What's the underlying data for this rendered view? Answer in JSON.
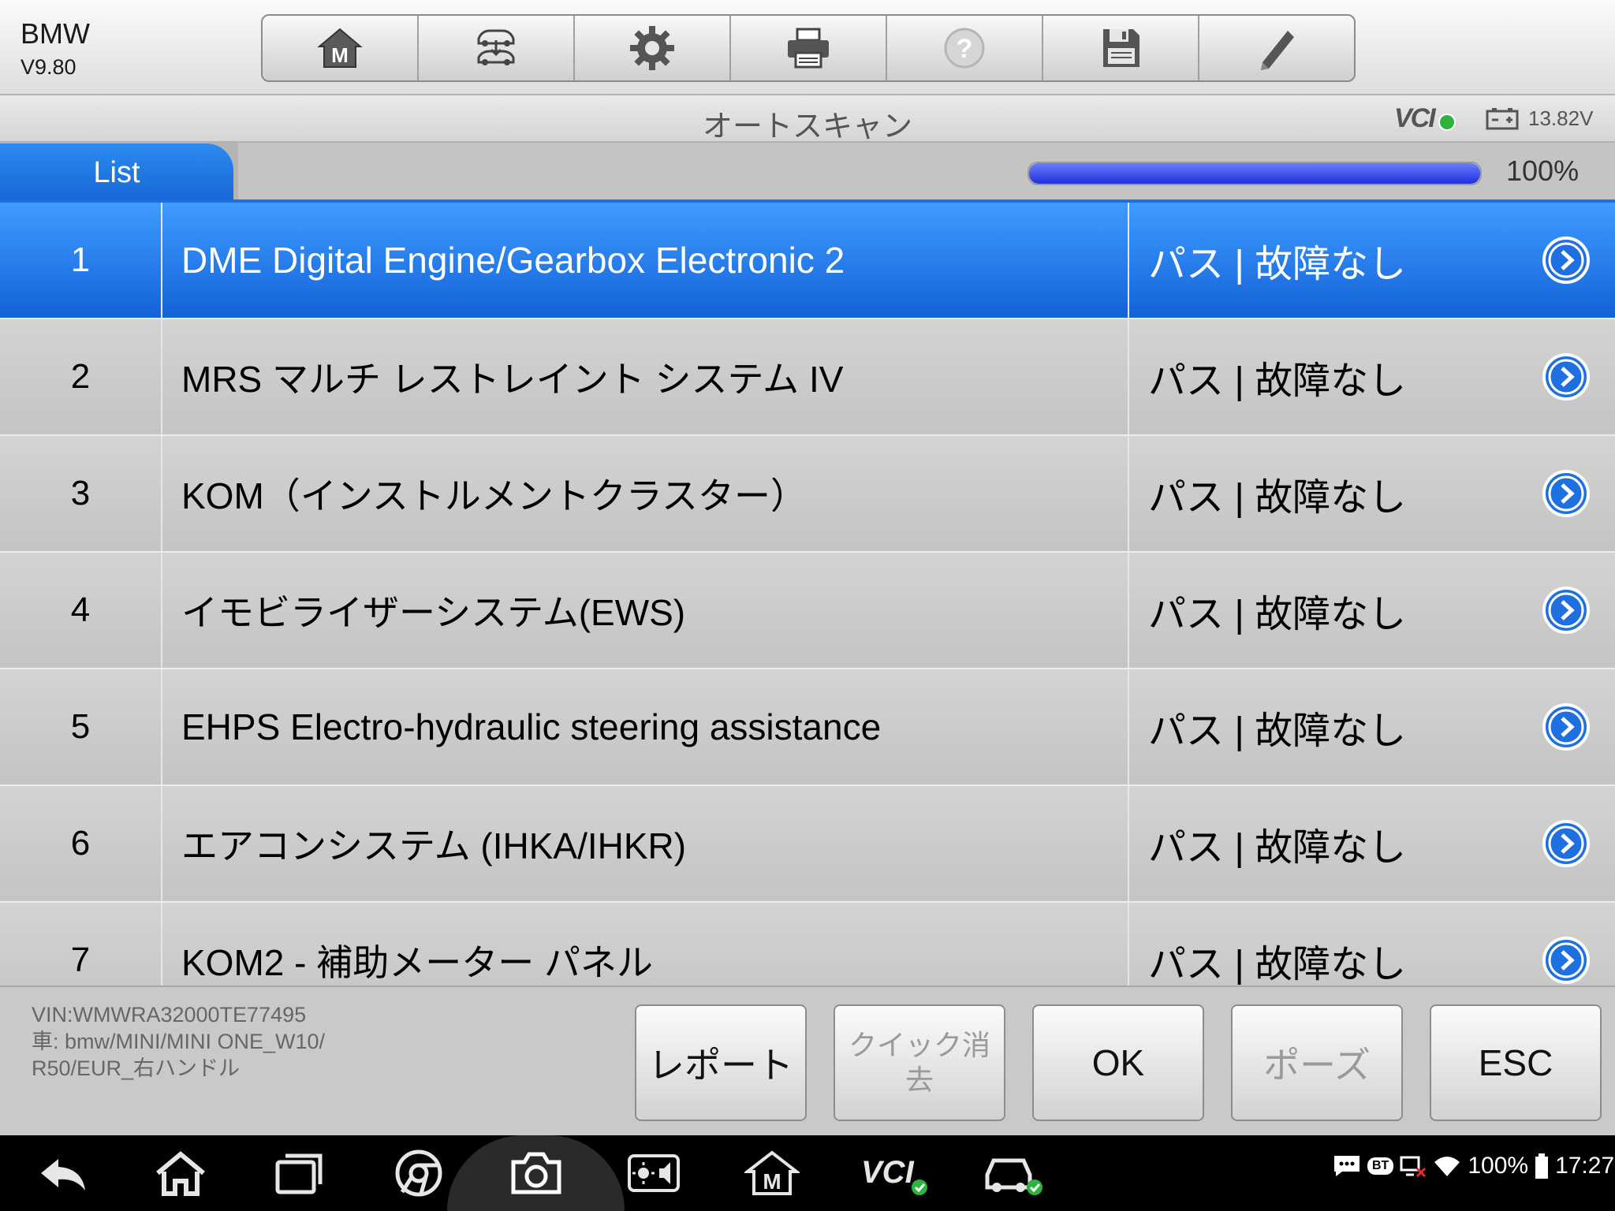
{
  "header": {
    "make": "BMW",
    "version": "V9.80",
    "toolbar": [
      {
        "name": "home-m-icon",
        "enabled": true
      },
      {
        "name": "vehicle-swap-icon",
        "enabled": true
      },
      {
        "name": "gear-icon",
        "enabled": true
      },
      {
        "name": "printer-icon",
        "enabled": true
      },
      {
        "name": "help-icon",
        "enabled": false
      },
      {
        "name": "save-icon",
        "enabled": true
      },
      {
        "name": "pencil-icon",
        "enabled": true
      }
    ]
  },
  "titlebar": {
    "title": "オートスキャン",
    "vci_label": "VCI",
    "voltage": "13.82V"
  },
  "tabs": {
    "list_label": "List"
  },
  "progress": {
    "value": 1.0,
    "label": "100%"
  },
  "rows": [
    {
      "num": "1",
      "name": "DME Digital Engine/Gearbox Electronic 2",
      "status": "パス | 故障なし",
      "selected": true
    },
    {
      "num": "2",
      "name": "MRS マルチ レストレイント システム IV",
      "status": "パス | 故障なし",
      "selected": false
    },
    {
      "num": "3",
      "name": "KOM（インストルメントクラスター）",
      "status": "パス | 故障なし",
      "selected": false
    },
    {
      "num": "4",
      "name": "イモビライザーシステム(EWS)",
      "status": "パス | 故障なし",
      "selected": false
    },
    {
      "num": "5",
      "name": "EHPS Electro-hydraulic steering assistance",
      "status": "パス | 故障なし",
      "selected": false
    },
    {
      "num": "6",
      "name": "エアコンシステム (IHKA/IHKR)",
      "status": "パス | 故障なし",
      "selected": false
    },
    {
      "num": "7",
      "name": "KOM2 - 補助メーター パネル",
      "status": "パス | 故障なし",
      "selected": false
    }
  ],
  "footer": {
    "vin": "VIN:WMWRA32000TE77495",
    "vehicle_line1": "車: bmw/MINI/MINI ONE_W10/",
    "vehicle_line2": "R50/EUR_右ハンドル",
    "buttons": {
      "report": "レポート",
      "quick_clear": "クイック消去",
      "ok": "OK",
      "pause": "ポーズ",
      "esc": "ESC"
    }
  },
  "navbar": {
    "battery_pct": "100%",
    "time": "17:27",
    "bt_label": "BT"
  },
  "colors": {
    "accent": "#1b6fe0",
    "selected_row": "#2a82ee",
    "vci_ok": "#2eb33c"
  }
}
